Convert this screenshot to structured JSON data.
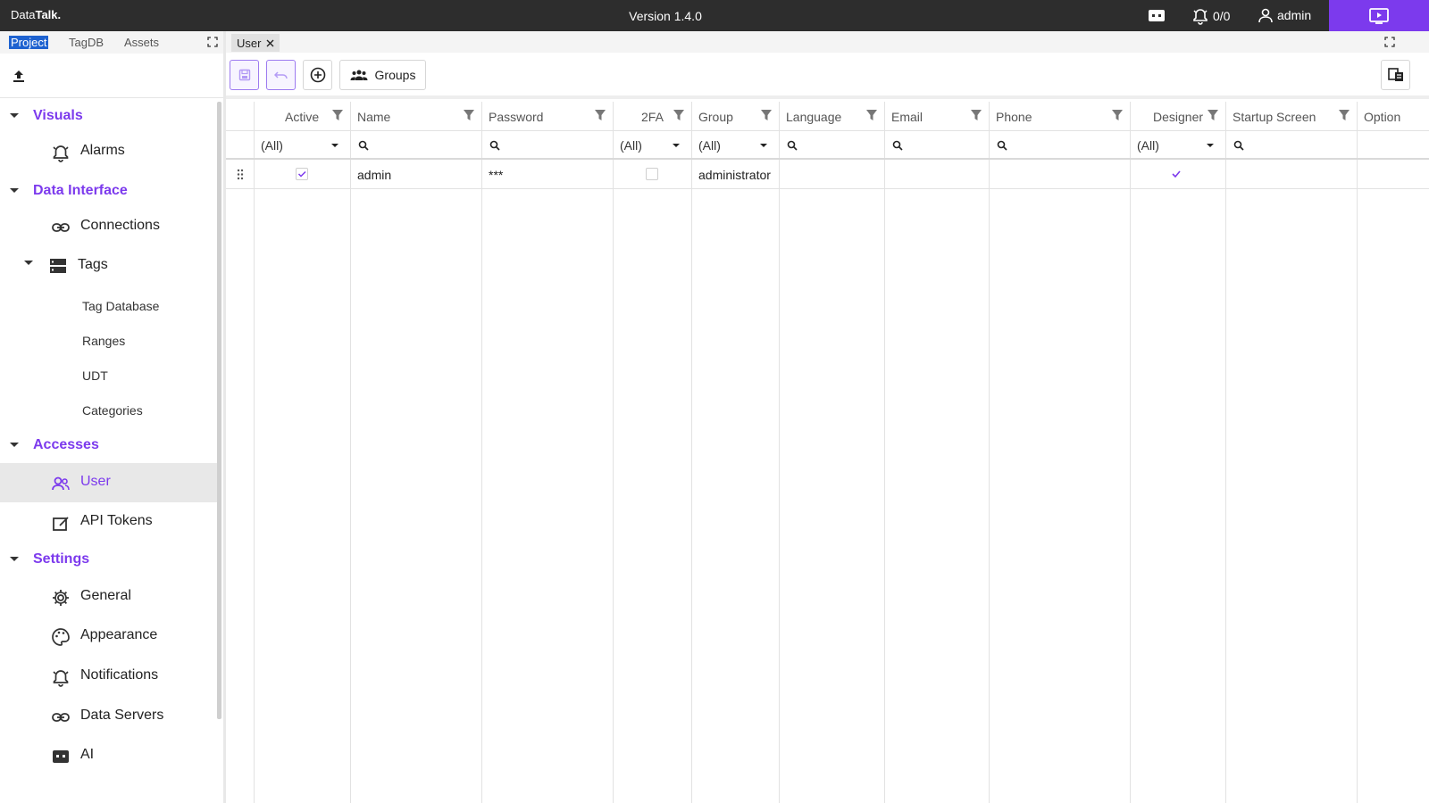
{
  "topbar": {
    "logo_left": "Data",
    "logo_right": "Talk.",
    "version": "Version 1.4.0",
    "alarm_count": "0/0",
    "user": "admin"
  },
  "left_tabs": [
    "Project",
    "TagDB",
    "Assets"
  ],
  "tree": {
    "visuals": {
      "title": "Visuals",
      "items": [
        "Alarms"
      ]
    },
    "data_interface": {
      "title": "Data Interface",
      "connections": "Connections",
      "tags": "Tags",
      "tag_children": [
        "Tag Database",
        "Ranges",
        "UDT",
        "Categories"
      ]
    },
    "accesses": {
      "title": "Accesses",
      "items": [
        "User",
        "API Tokens"
      ]
    },
    "settings": {
      "title": "Settings",
      "items": [
        "General",
        "Appearance",
        "Notifications",
        "Data Servers",
        "AI"
      ]
    }
  },
  "doc_tab": "User",
  "toolbar": {
    "groups_label": "Groups"
  },
  "grid": {
    "columns": [
      "Active",
      "Name",
      "Password",
      "2FA",
      "Group",
      "Language",
      "Email",
      "Phone",
      "Designer",
      "Startup Screen",
      "Option"
    ],
    "filters": {
      "all": "(All)"
    },
    "rows": [
      {
        "active": true,
        "name": "admin",
        "password": "***",
        "twofa": false,
        "group": "administrator",
        "language": "",
        "email": "",
        "phone": "",
        "designer": true,
        "startup": ""
      }
    ]
  },
  "colors": {
    "accent": "#7c3aed",
    "topbar": "#2d2d2d",
    "selected": "#1e62d0"
  }
}
